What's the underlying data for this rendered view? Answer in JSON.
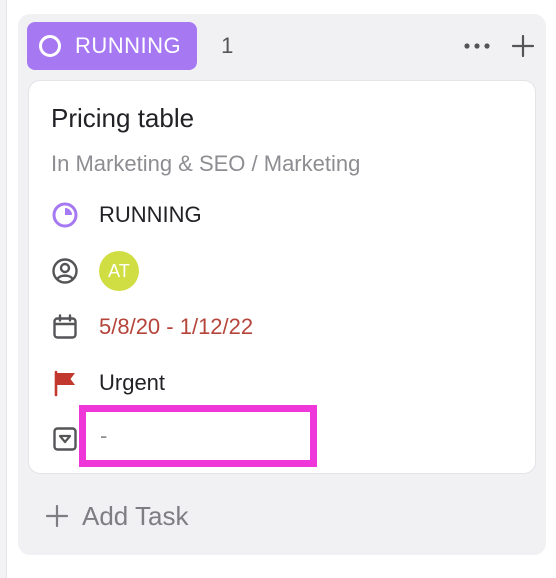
{
  "column": {
    "status_label": "RUNNING",
    "count": "1",
    "accent_color": "#a679f3",
    "actions": {
      "more_icon": "ellipsis-icon",
      "add_icon": "plus-icon"
    }
  },
  "card": {
    "title": "Pricing table",
    "location": "In Marketing & SEO / Marketing",
    "status": {
      "icon": "status-circle-icon",
      "text": "RUNNING"
    },
    "assignee": {
      "icon": "user-circle-icon",
      "initials": "AT",
      "avatar_color": "#d0de44"
    },
    "dates": {
      "icon": "calendar-icon",
      "text": "5/8/20 - 1/12/22",
      "color": "#b5453b"
    },
    "priority": {
      "icon": "flag-icon",
      "text": "Urgent",
      "color": "#c2382e"
    },
    "dropdown": {
      "icon": "dropdown-field-icon",
      "value": "-"
    }
  },
  "footer": {
    "add_task_label": "Add Task"
  }
}
